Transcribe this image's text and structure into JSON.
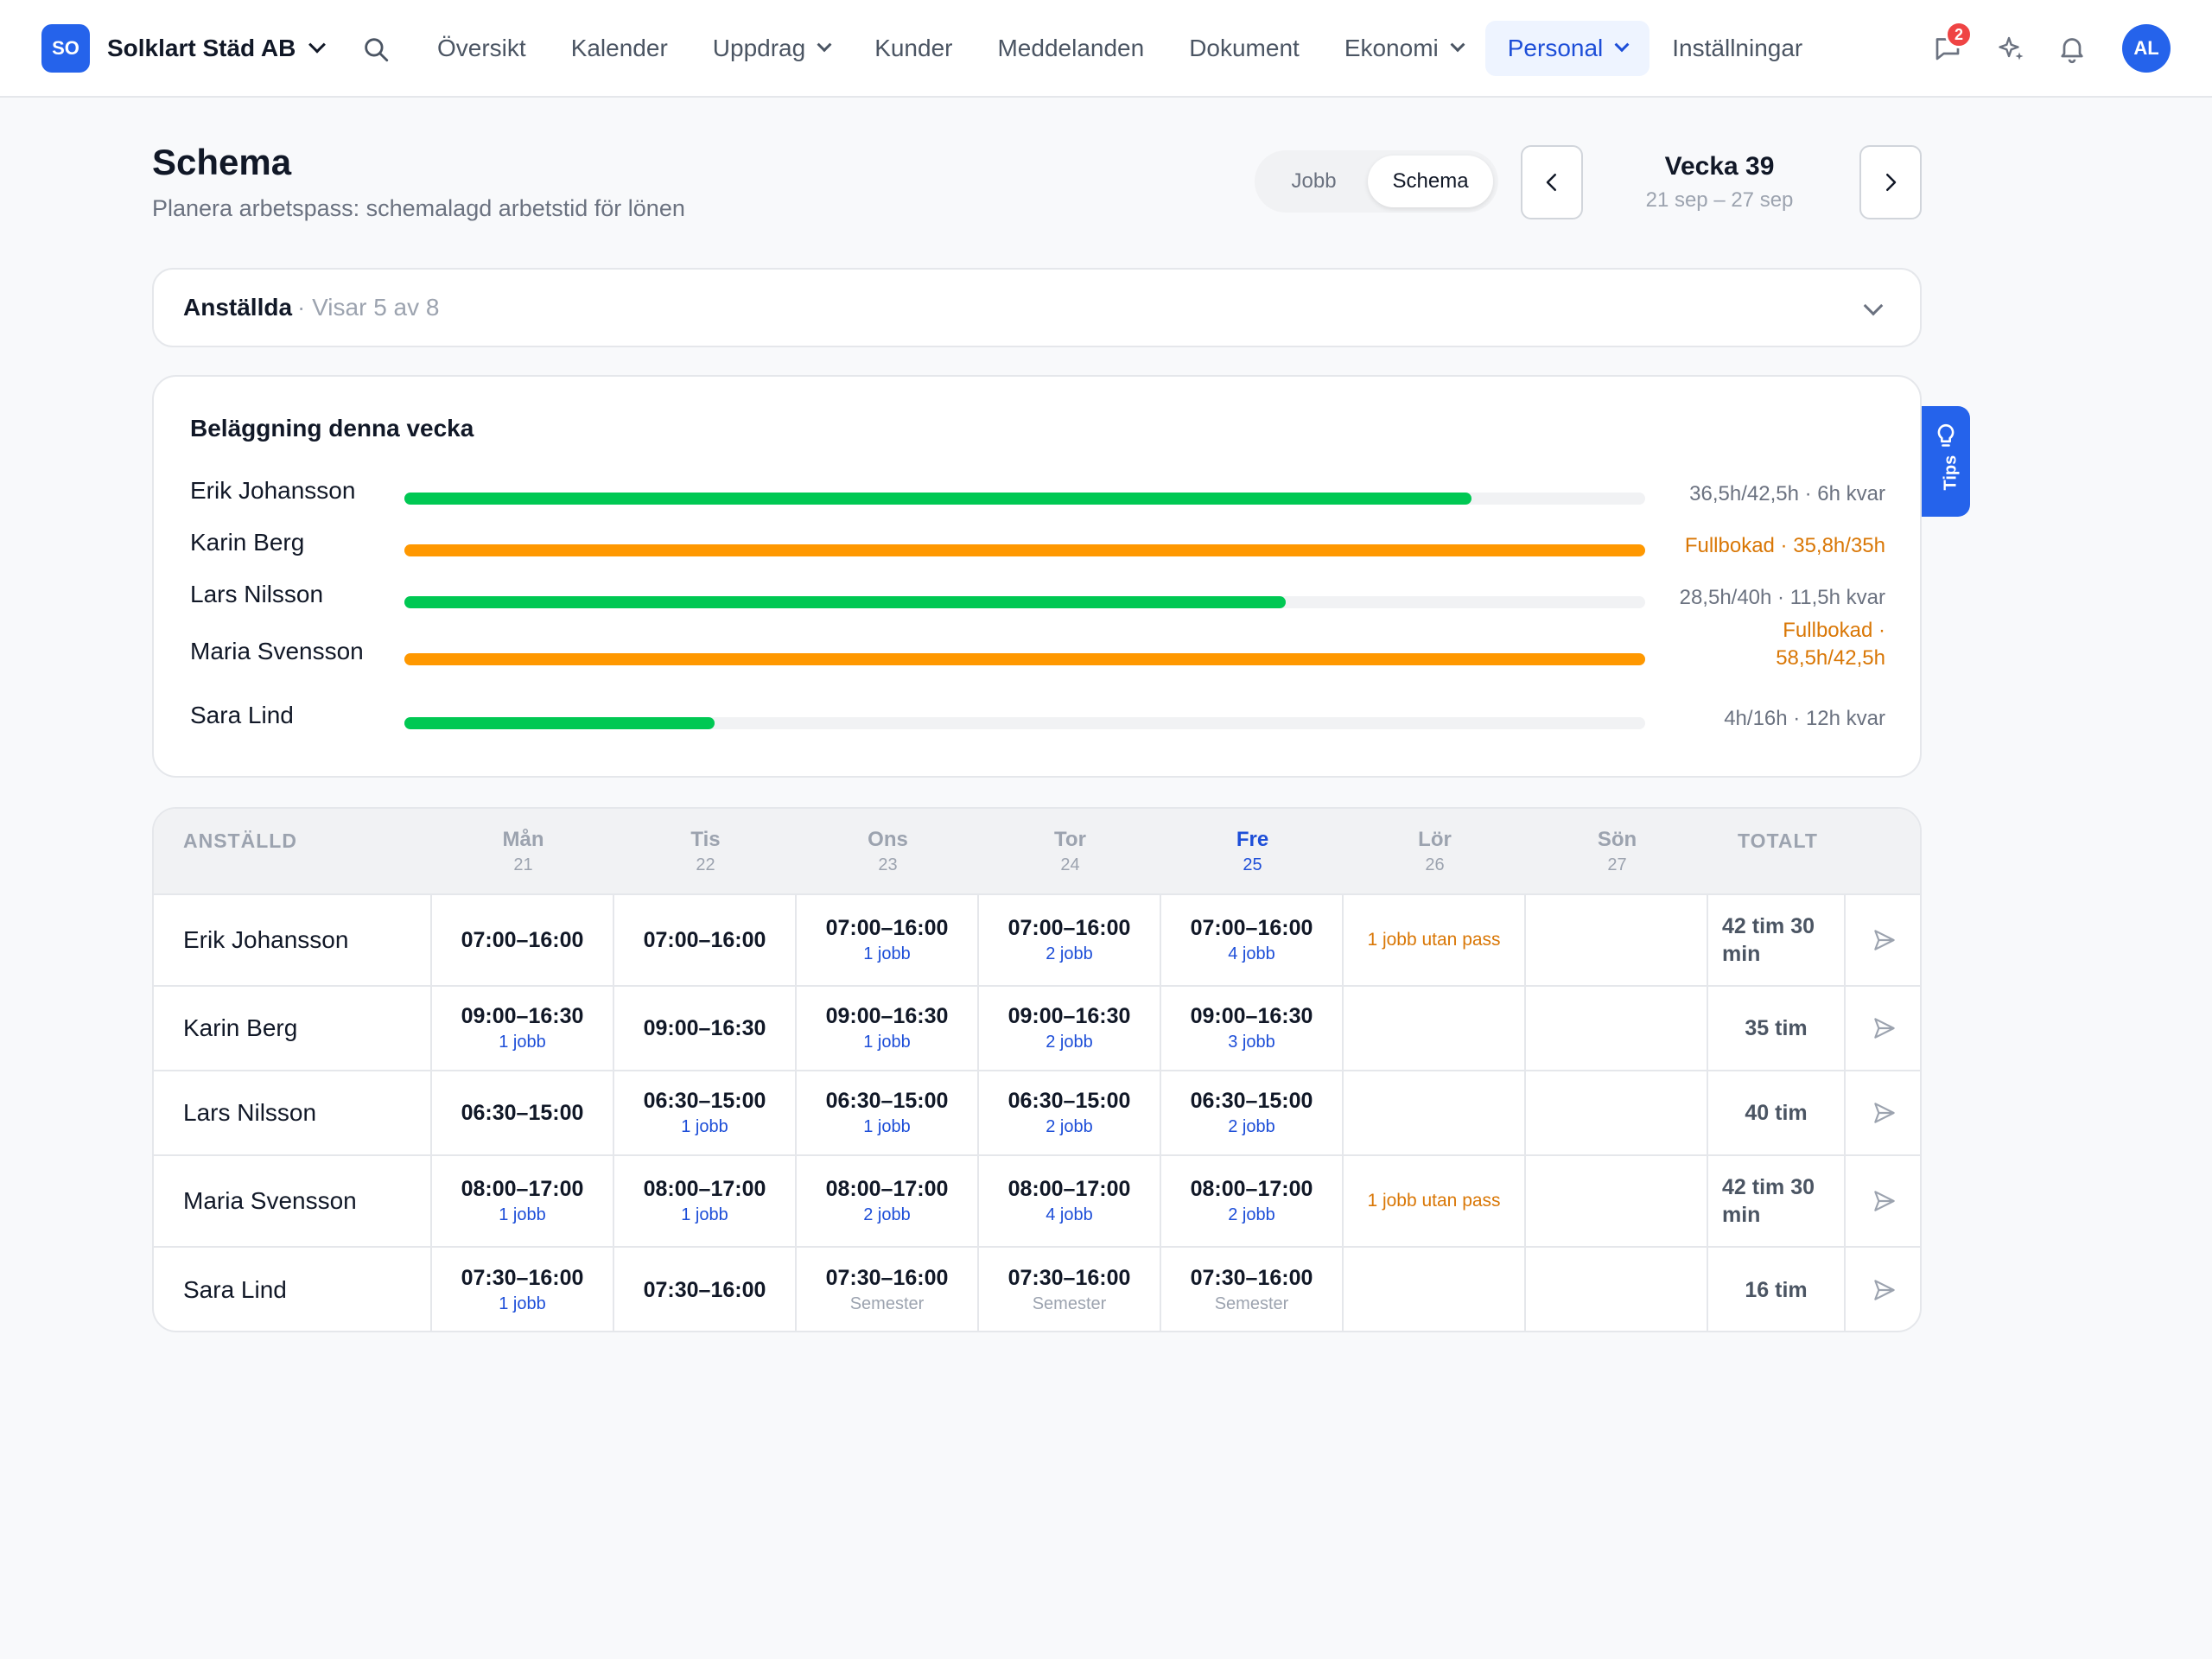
{
  "nav": {
    "logo_initials": "SO",
    "company": "Solklart Städ AB",
    "links": [
      "Översikt",
      "Kalender",
      "Uppdrag",
      "Kunder",
      "Meddelanden",
      "Dokument",
      "Ekonomi",
      "Personal",
      "Inställningar"
    ],
    "active": "Personal",
    "chat_badge": "2",
    "avatar_initials": "AL",
    "accent": "#2563eb"
  },
  "header": {
    "title": "Schema",
    "subtitle": "Planera arbetspass: schemalagd arbetstid för lönen",
    "toggle": [
      "Jobb",
      "Schema"
    ],
    "toggle_selected": "Schema",
    "week_title": "Vecka 39",
    "week_range": "21 sep – 27 sep"
  },
  "filter": {
    "label": "Anställda",
    "count": "· Visar 5 av 8"
  },
  "occupancy": {
    "title": "Beläggning denna vecka",
    "rows": [
      {
        "name": "Erik Johansson",
        "fraction": 0.86,
        "status": "ok",
        "value": "36,5h/42,5h · 6h kvar"
      },
      {
        "name": "Karin Berg",
        "fraction": 1.0,
        "status": "full",
        "value": "Fullbokad · 35,8h/35h"
      },
      {
        "name": "Lars Nilsson",
        "fraction": 0.71,
        "status": "ok",
        "value": "28,5h/40h · 11,5h kvar"
      },
      {
        "name": "Maria Svensson",
        "fraction": 1.0,
        "status": "full",
        "value_line1": "Fullbokad ·",
        "value_line2": "58,5h/42,5h"
      },
      {
        "name": "Sara Lind",
        "fraction": 0.25,
        "status": "ok",
        "value": "4h/16h · 12h kvar"
      }
    ],
    "colors": {
      "ok": "#00c853",
      "full": "#ff9800",
      "track": "#f1f2f4"
    }
  },
  "tips_label": "Tips",
  "schedule": {
    "head_employee": "ANSTÄLLD",
    "head_total": "TOTALT",
    "days": [
      {
        "d": "Mån",
        "n": "21"
      },
      {
        "d": "Tis",
        "n": "22"
      },
      {
        "d": "Ons",
        "n": "23"
      },
      {
        "d": "Tor",
        "n": "24"
      },
      {
        "d": "Fre",
        "n": "25",
        "today": true
      },
      {
        "d": "Lör",
        "n": "26"
      },
      {
        "d": "Sön",
        "n": "27"
      }
    ],
    "rows": [
      {
        "name": "Erik Johansson",
        "total": "42 tim 30 min",
        "cells": [
          {
            "t": "07:00–16:00"
          },
          {
            "t": "07:00–16:00"
          },
          {
            "t": "07:00–16:00",
            "j": "1 jobb"
          },
          {
            "t": "07:00–16:00",
            "j": "2 jobb"
          },
          {
            "t": "07:00–16:00",
            "j": "4 jobb"
          },
          {
            "warn": "1 jobb utan pass"
          },
          {}
        ]
      },
      {
        "name": "Karin Berg",
        "total": "35 tim",
        "cells": [
          {
            "t": "09:00–16:30",
            "j": "1 jobb"
          },
          {
            "t": "09:00–16:30"
          },
          {
            "t": "09:00–16:30",
            "j": "1 jobb"
          },
          {
            "t": "09:00–16:30",
            "j": "2 jobb"
          },
          {
            "t": "09:00–16:30",
            "j": "3 jobb"
          },
          {},
          {}
        ]
      },
      {
        "name": "Lars Nilsson",
        "total": "40 tim",
        "cells": [
          {
            "t": "06:30–15:00"
          },
          {
            "t": "06:30–15:00",
            "j": "1 jobb"
          },
          {
            "t": "06:30–15:00",
            "j": "1 jobb"
          },
          {
            "t": "06:30–15:00",
            "j": "2 jobb"
          },
          {
            "t": "06:30–15:00",
            "j": "2 jobb"
          },
          {},
          {}
        ]
      },
      {
        "name": "Maria Svensson",
        "total": "42 tim 30 min",
        "cells": [
          {
            "t": "08:00–17:00",
            "j": "1 jobb"
          },
          {
            "t": "08:00–17:00",
            "j": "1 jobb"
          },
          {
            "t": "08:00–17:00",
            "j": "2 jobb"
          },
          {
            "t": "08:00–17:00",
            "j": "4 jobb"
          },
          {
            "t": "08:00–17:00",
            "j": "2 jobb"
          },
          {
            "warn": "1 jobb utan pass"
          },
          {}
        ]
      },
      {
        "name": "Sara Lind",
        "total": "16 tim",
        "cells": [
          {
            "t": "07:30–16:00",
            "j": "1 jobb"
          },
          {
            "t": "07:30–16:00"
          },
          {
            "t": "07:30–16:00",
            "s": "Semester"
          },
          {
            "t": "07:30–16:00",
            "s": "Semester"
          },
          {
            "t": "07:30–16:00",
            "s": "Semester"
          },
          {},
          {}
        ]
      }
    ]
  }
}
